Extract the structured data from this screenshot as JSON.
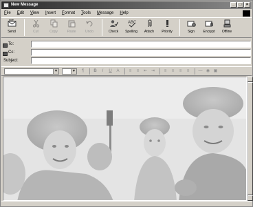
{
  "window": {
    "title": "New Message",
    "controls": [
      "_",
      "□",
      "×"
    ]
  },
  "menu": [
    "File",
    "Edit",
    "View",
    "Insert",
    "Format",
    "Tools",
    "Message",
    "Help"
  ],
  "toolbar": [
    {
      "label": "Send",
      "icon": "send-icon",
      "enabled": true
    },
    {
      "label": "Cut",
      "icon": "cut-icon",
      "enabled": false
    },
    {
      "label": "Copy",
      "icon": "copy-icon",
      "enabled": false
    },
    {
      "label": "Paste",
      "icon": "paste-icon",
      "enabled": false
    },
    {
      "label": "Undo",
      "icon": "undo-icon",
      "enabled": false
    },
    {
      "label": "Check",
      "icon": "check-names-icon",
      "enabled": true
    },
    {
      "label": "Spelling",
      "icon": "spelling-icon",
      "enabled": true
    },
    {
      "label": "Attach",
      "icon": "attach-icon",
      "enabled": true
    },
    {
      "label": "Priority",
      "icon": "priority-icon",
      "enabled": true
    },
    {
      "label": "Sign",
      "icon": "sign-icon",
      "enabled": true
    },
    {
      "label": "Encrypt",
      "icon": "encrypt-icon",
      "enabled": true
    },
    {
      "label": "Offline",
      "icon": "offline-icon",
      "enabled": true
    }
  ],
  "fields": {
    "to_label": "To:",
    "to_value": "",
    "cc_label": "Cc:",
    "cc_value": "",
    "subject_label": "Subject:",
    "subject_value": ""
  },
  "format_bar": {
    "font_value": "",
    "size_value": "",
    "buttons": [
      "paragraph-style-icon",
      "bold-icon",
      "italic-icon",
      "underline-icon",
      "font-color-icon",
      "numbering-icon",
      "bullets-icon",
      "decrease-indent-icon",
      "increase-indent-icon",
      "align-left-icon",
      "center-icon",
      "align-right-icon",
      "justify-icon",
      "horizontal-line-icon",
      "hyperlink-icon",
      "insert-picture-icon"
    ]
  },
  "body": {
    "image_description": "Grayscale photo of a family in fur hats in snow"
  }
}
